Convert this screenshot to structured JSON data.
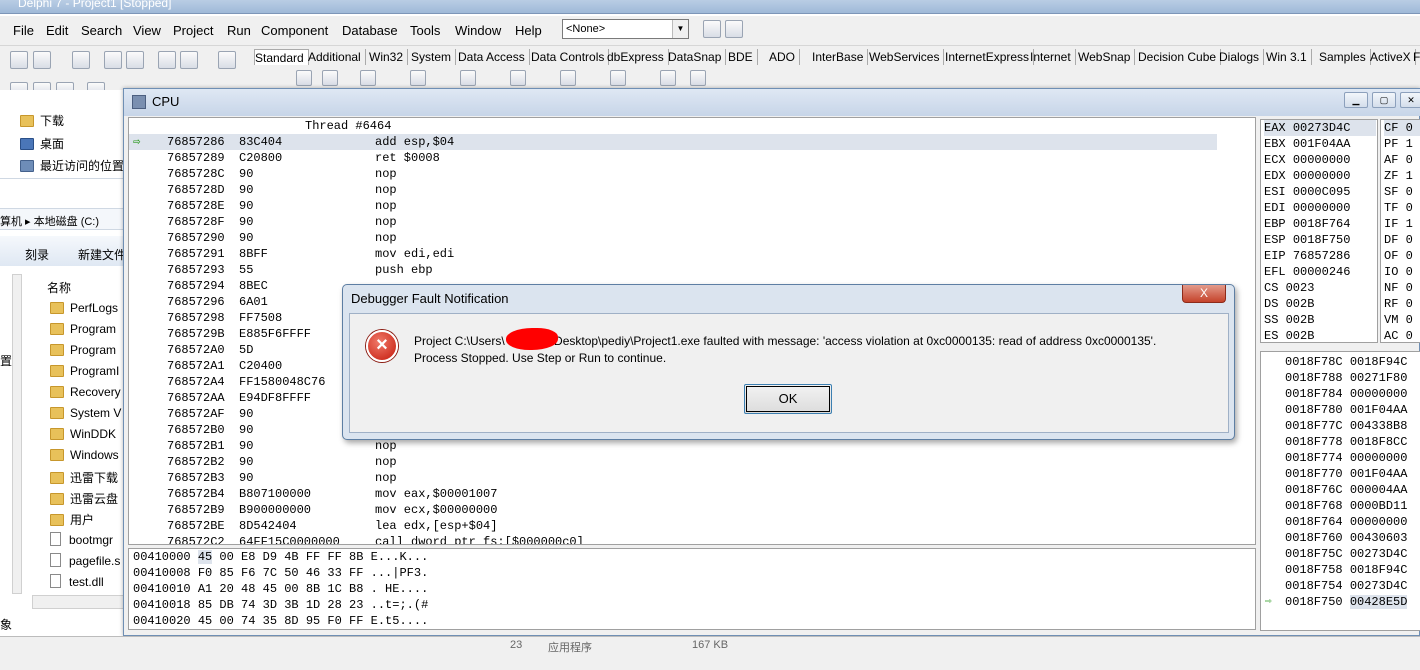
{
  "ide": {
    "title": "Delphi 7 - Project1 [Stopped]",
    "menu": [
      "File",
      "Edit",
      "Search",
      "View",
      "Project",
      "Run",
      "Component",
      "Database",
      "Tools",
      "Window",
      "Help"
    ],
    "selector_value": "<None>",
    "palette_tabs": [
      "Standard",
      "Additional",
      "Win32",
      "System",
      "Data Access",
      "Data Controls",
      "dbExpress",
      "DataSnap",
      "BDE",
      "ADO",
      "InterBase",
      "WebServices",
      "InternetExpress",
      "Internet",
      "WebSnap",
      "Decision Cube",
      "Dialogs",
      "Win 3.1",
      "Samples",
      "ActiveX",
      "F"
    ]
  },
  "explorer": {
    "nav": [
      "下载",
      "桌面",
      "最近访问的位置"
    ],
    "breadcrumb": "算机 ▸ 本地磁盘 (C:)",
    "toolbar": [
      "刻录",
      "新建文件"
    ],
    "column": "名称",
    "items": [
      "PerfLogs",
      "Program",
      "Program",
      "ProgramI",
      "Recovery",
      "System V",
      "WinDDK",
      "Windows",
      "迅雷下载",
      "迅雷云盘",
      "用户",
      "bootmgr",
      "pagefile.s",
      "test.dll"
    ],
    "left_edge_labels": [
      "置",
      "象"
    ]
  },
  "cpu": {
    "title": "CPU",
    "thread": "Thread #6464",
    "disasm": [
      {
        "addr": "76857286",
        "hex": "83C404",
        "ins": "add esp,$04"
      },
      {
        "addr": "76857289",
        "hex": "C20800",
        "ins": "ret $0008"
      },
      {
        "addr": "7685728C",
        "hex": "90",
        "ins": "nop"
      },
      {
        "addr": "7685728D",
        "hex": "90",
        "ins": "nop"
      },
      {
        "addr": "7685728E",
        "hex": "90",
        "ins": "nop"
      },
      {
        "addr": "7685728F",
        "hex": "90",
        "ins": "nop"
      },
      {
        "addr": "76857290",
        "hex": "90",
        "ins": "nop"
      },
      {
        "addr": "76857291",
        "hex": "8BFF",
        "ins": "mov edi,edi"
      },
      {
        "addr": "76857293",
        "hex": "55",
        "ins": "push ebp"
      },
      {
        "addr": "76857294",
        "hex": "8BEC",
        "ins": ""
      },
      {
        "addr": "76857296",
        "hex": "6A01",
        "ins": ""
      },
      {
        "addr": "76857298",
        "hex": "FF7508",
        "ins": ""
      },
      {
        "addr": "7685729B",
        "hex": "E885F6FFFF",
        "ins": ""
      },
      {
        "addr": "768572A0",
        "hex": "5D",
        "ins": ""
      },
      {
        "addr": "768572A1",
        "hex": "C20400",
        "ins": ""
      },
      {
        "addr": "768572A4",
        "hex": "FF1580048C76",
        "ins": ""
      },
      {
        "addr": "768572AA",
        "hex": "E94DF8FFFF",
        "ins": ""
      },
      {
        "addr": "768572AF",
        "hex": "90",
        "ins": ""
      },
      {
        "addr": "768572B0",
        "hex": "90",
        "ins": ""
      },
      {
        "addr": "768572B1",
        "hex": "90",
        "ins": "nop"
      },
      {
        "addr": "768572B2",
        "hex": "90",
        "ins": "nop"
      },
      {
        "addr": "768572B3",
        "hex": "90",
        "ins": "nop"
      },
      {
        "addr": "768572B4",
        "hex": "B807100000",
        "ins": "mov eax,$00001007"
      },
      {
        "addr": "768572B9",
        "hex": "B900000000",
        "ins": "mov ecx,$00000000"
      },
      {
        "addr": "768572BE",
        "hex": "8D542404",
        "ins": "lea edx,[esp+$04]"
      },
      {
        "addr": "768572C2",
        "hex": "64FF15C0000000",
        "ins": "call dword ptr fs:[$000000c0]"
      }
    ],
    "dump": [
      {
        "addr": "00410000",
        "sel": "45",
        "bytes": "00 E8 D9 4B FF FF 8B",
        "ascii": "E...K..."
      },
      {
        "addr": "00410008",
        "sel": "",
        "bytes": "F0 85 F6 7C 50 46 33 FF",
        "ascii": "...|PF3."
      },
      {
        "addr": "00410010",
        "sel": "",
        "bytes": "A1 20 48 45 00 8B 1C B8",
        "ascii": ". HE...."
      },
      {
        "addr": "00410018",
        "sel": "",
        "bytes": "85 DB 74 3D 3B 1D 28 23",
        "ascii": "..t=;.(#"
      },
      {
        "addr": "00410020",
        "sel": "",
        "bytes": "45 00 74 35 8D 95 F0 FF",
        "ascii": "E.t5...."
      }
    ],
    "registers": [
      {
        "name": "EAX",
        "val": "00273D4C"
      },
      {
        "name": "EBX",
        "val": "001F04AA"
      },
      {
        "name": "ECX",
        "val": "00000000"
      },
      {
        "name": "EDX",
        "val": "00000000"
      },
      {
        "name": "ESI",
        "val": "0000C095"
      },
      {
        "name": "EDI",
        "val": "00000000"
      },
      {
        "name": "EBP",
        "val": "0018F764"
      },
      {
        "name": "ESP",
        "val": "0018F750"
      },
      {
        "name": "EIP",
        "val": "76857286"
      },
      {
        "name": "EFL",
        "val": "00000246"
      },
      {
        "name": "CS",
        "val": "0023"
      },
      {
        "name": "DS",
        "val": "002B"
      },
      {
        "name": "SS",
        "val": "002B"
      },
      {
        "name": "ES",
        "val": "002B"
      }
    ],
    "flags": [
      {
        "name": "CF",
        "val": "0"
      },
      {
        "name": "PF",
        "val": "1"
      },
      {
        "name": "AF",
        "val": "0"
      },
      {
        "name": "ZF",
        "val": "1"
      },
      {
        "name": "SF",
        "val": "0"
      },
      {
        "name": "TF",
        "val": "0"
      },
      {
        "name": "IF",
        "val": "1"
      },
      {
        "name": "DF",
        "val": "0"
      },
      {
        "name": "OF",
        "val": "0"
      },
      {
        "name": "IO",
        "val": "0"
      },
      {
        "name": "NF",
        "val": "0"
      },
      {
        "name": "RF",
        "val": "0"
      },
      {
        "name": "VM",
        "val": "0"
      },
      {
        "name": "AC",
        "val": "0"
      }
    ],
    "stack": [
      {
        "addr": "0018F78C",
        "val": "0018F94C"
      },
      {
        "addr": "0018F788",
        "val": "00271F80"
      },
      {
        "addr": "0018F784",
        "val": "00000000"
      },
      {
        "addr": "0018F780",
        "val": "001F04AA"
      },
      {
        "addr": "0018F77C",
        "val": "004338B8"
      },
      {
        "addr": "0018F778",
        "val": "0018F8CC"
      },
      {
        "addr": "0018F774",
        "val": "00000000"
      },
      {
        "addr": "0018F770",
        "val": "001F04AA"
      },
      {
        "addr": "0018F76C",
        "val": "000004AA"
      },
      {
        "addr": "0018F768",
        "val": "0000BD11"
      },
      {
        "addr": "0018F764",
        "val": "00000000"
      },
      {
        "addr": "0018F760",
        "val": "00430603"
      },
      {
        "addr": "0018F75C",
        "val": "00273D4C"
      },
      {
        "addr": "0018F758",
        "val": "0018F94C"
      },
      {
        "addr": "0018F754",
        "val": "00273D4C"
      },
      {
        "addr": "0018F750",
        "val": "00428E5D"
      }
    ]
  },
  "dialog": {
    "title": "Debugger Fault Notification",
    "close": "X",
    "line1_a": "Project C:\\Users\\",
    "line1_b": "\\Desktop\\pediy\\Project1.exe faulted with message: 'access violation at 0xc0000135: read of address 0xc0000135'.",
    "line2": "Process Stopped. Use Step or Run to continue.",
    "ok": "OK"
  },
  "statusbar": {
    "left": "23",
    "mid": "应用程序",
    "right": "167 KB"
  }
}
